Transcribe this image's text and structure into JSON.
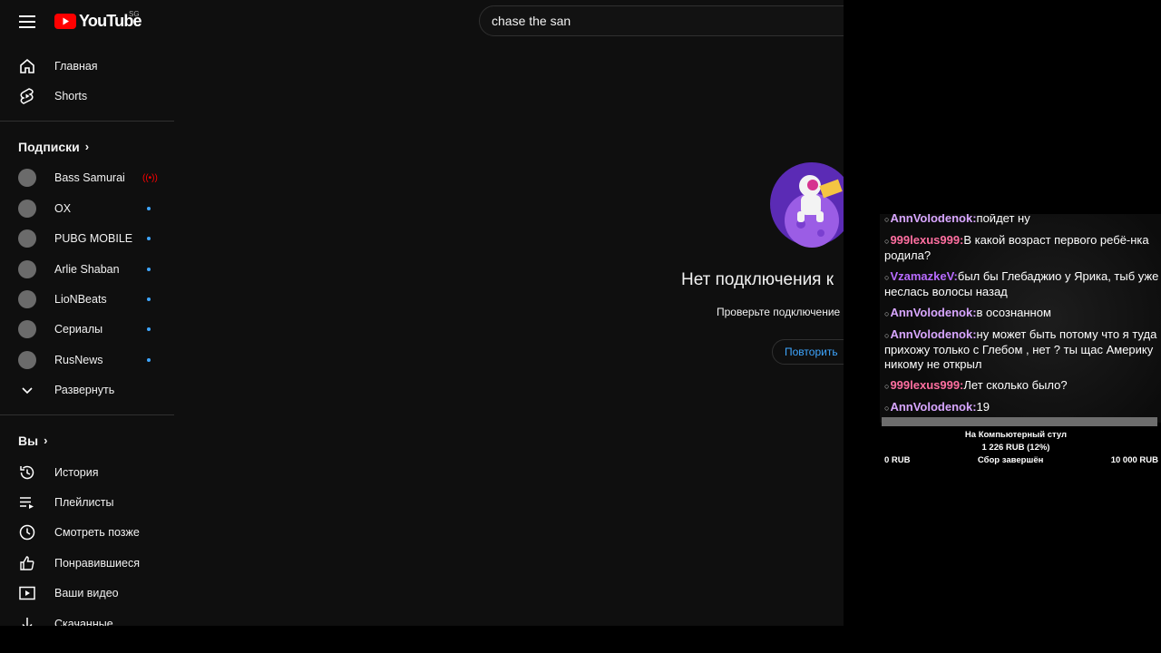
{
  "header": {
    "logo_text": "YouTube",
    "region": "SG",
    "search_value": "chase the san"
  },
  "sidebar": {
    "main": [
      {
        "label": "Главная",
        "icon": "home-icon"
      },
      {
        "label": "Shorts",
        "icon": "shorts-icon"
      }
    ],
    "subscriptions_title": "Подписки",
    "subscriptions": [
      {
        "label": "Bass Samurai",
        "status": "live"
      },
      {
        "label": "OX",
        "status": "new"
      },
      {
        "label": "PUBG MOBILE",
        "status": "new"
      },
      {
        "label": "Arlie Shaban",
        "status": "new"
      },
      {
        "label": "LioNBeats",
        "status": "new"
      },
      {
        "label": "Сериалы",
        "status": "new"
      },
      {
        "label": "RusNews",
        "status": "new"
      }
    ],
    "expand_label": "Развернуть",
    "you_title": "Вы",
    "you_items": [
      {
        "label": "История",
        "icon": "history-icon"
      },
      {
        "label": "Плейлисты",
        "icon": "playlists-icon"
      },
      {
        "label": "Смотреть позже",
        "icon": "watch-later-icon"
      },
      {
        "label": "Понравившиеся",
        "icon": "thumbs-up-icon"
      },
      {
        "label": "Ваши видео",
        "icon": "your-videos-icon"
      },
      {
        "label": "Скачанные",
        "icon": "download-icon"
      }
    ]
  },
  "offline": {
    "title": "Нет подключения к",
    "subtitle": "Проверьте подключение",
    "retry": "Повторить"
  },
  "chat": {
    "messages": [
      {
        "nick": "AnnVolodenok:",
        "text": "пойдет ну",
        "color": "#d8a6ff"
      },
      {
        "nick": "999lexus999:",
        "text": "В какой возраст первого ребё-нка родила?",
        "color": "#ff6fa0"
      },
      {
        "nick": "VzamazkeV:",
        "text": "был бы Глебаджио у Ярика, тыб уже неслась волосы назад",
        "color": "#b86bff"
      },
      {
        "nick": "AnnVolodenok:",
        "text": "в осознанном",
        "color": "#d8a6ff"
      },
      {
        "nick": "AnnVolodenok:",
        "text": "ну может быть потому что я туда прихожу только с Глебом , нет ? ты щас Америку никому не открыл",
        "color": "#d8a6ff"
      },
      {
        "nick": "999lexus999:",
        "text": "Лет сколько было?",
        "color": "#ff6fa0"
      },
      {
        "nick": "AnnVolodenok:",
        "text": "19",
        "color": "#d8a6ff"
      }
    ]
  },
  "donation": {
    "goal": "На Компьютерный стул",
    "amount": "1 226 RUB (12%)",
    "min": "0 RUB",
    "status": "Сбор завершён",
    "max": "10 000 RUB",
    "progress_fraction": 0.12
  },
  "colors": {
    "yt_bg": "#0f0f0f",
    "accent_blue": "#3ea6ff",
    "live_red": "#ff0000"
  }
}
